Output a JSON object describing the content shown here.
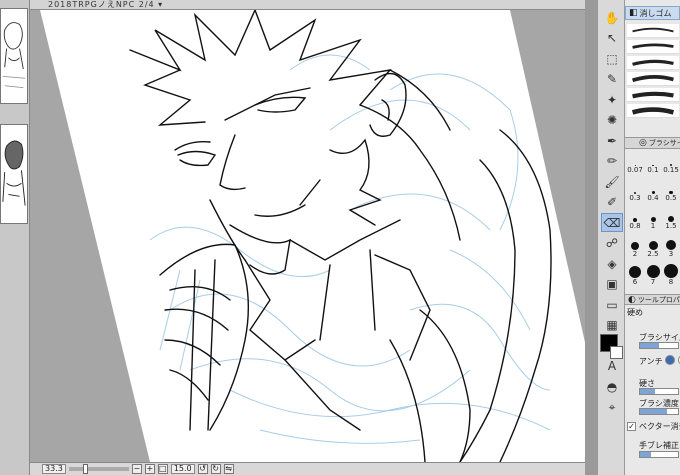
{
  "window": {
    "doc_tab_label": "2018TRPGノえNPC 2/4 ▾"
  },
  "canvas": {
    "ink_color": "#111111",
    "guide_color": "#a9cde8",
    "paper_color": "#ffffff",
    "background_color": "#a6a6a6"
  },
  "statusbar": {
    "zoom": "33.3",
    "brush_value": "15.0"
  },
  "tools": [
    {
      "name": "hand-icon",
      "glyph": "✋"
    },
    {
      "name": "pointer-icon",
      "glyph": "↖"
    },
    {
      "name": "lasso-icon",
      "glyph": "⬚"
    },
    {
      "name": "eyedropper-icon",
      "glyph": "✎"
    },
    {
      "name": "wand-icon",
      "glyph": "✦"
    },
    {
      "name": "sparkle-icon",
      "glyph": "✺"
    },
    {
      "name": "pen-icon",
      "glyph": "✒"
    },
    {
      "name": "pencil-icon",
      "glyph": "✏"
    },
    {
      "name": "brush-icon",
      "glyph": "🖌"
    },
    {
      "name": "airbrush-icon",
      "glyph": "✐"
    },
    {
      "name": "eraser-icon",
      "glyph": "⌫"
    },
    {
      "name": "blend-icon",
      "glyph": "☍"
    },
    {
      "name": "fill-icon",
      "glyph": "◈"
    },
    {
      "name": "gradient-icon",
      "glyph": "▣"
    },
    {
      "name": "shape-icon",
      "glyph": "▭"
    },
    {
      "name": "frame-icon",
      "glyph": "▦"
    },
    {
      "name": "ruler-icon",
      "glyph": "⊿"
    },
    {
      "name": "text-icon",
      "glyph": "A"
    },
    {
      "name": "balloon-icon",
      "glyph": "◓"
    },
    {
      "name": "correct-icon",
      "glyph": "⌖"
    }
  ],
  "colors": {
    "main": "#000000",
    "sub": "#ffffff"
  },
  "panel": {
    "subtool_label": "消しゴム",
    "brush_size_label": "ブラシサイズ",
    "sizes": [
      {
        "label": "0.07",
        "size": 1
      },
      {
        "label": "0.1",
        "size": 1.5
      },
      {
        "label": "0.15",
        "size": 2
      },
      {
        "label": "0.3",
        "size": 2.5
      },
      {
        "label": "0.4",
        "size": 3
      },
      {
        "label": "0.5",
        "size": 3.5
      },
      {
        "label": "0.8",
        "size": 4
      },
      {
        "label": "1",
        "size": 5
      },
      {
        "label": "1.5",
        "size": 6
      },
      {
        "label": "2",
        "size": 8
      },
      {
        "label": "2.5",
        "size": 9
      },
      {
        "label": "3",
        "size": 10
      },
      {
        "label": "6",
        "size": 12
      },
      {
        "label": "7",
        "size": 13
      },
      {
        "label": "8",
        "size": 14
      }
    ],
    "toolprop_label": "ツールプロパ",
    "toolprop_name": "硬め",
    "brush_size": "ブラシサイズ",
    "antialias": "アンチ",
    "hardness": "硬さ",
    "density": "ブラシ濃度",
    "vector_erase": "ベクター消去",
    "stabilization": "手ブレ補正",
    "density_pct": 70,
    "hardness_pct": 40,
    "stabilization_pct": 30
  }
}
